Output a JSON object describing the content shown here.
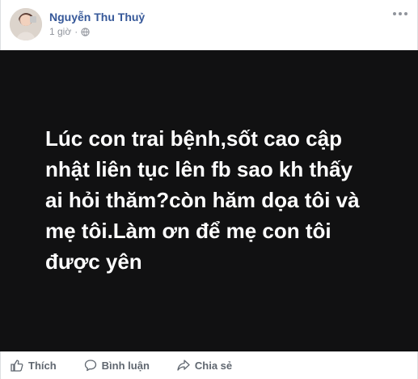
{
  "post": {
    "author": "Nguyễn Thu Thuỷ",
    "time": "1 giờ",
    "separator": "·",
    "status_text": "Lúc con trai bệnh,sốt cao cập\nnhật liên tục lên fb sao kh thấy\nai hỏi thăm?còn hăm dọa tôi và\nmẹ tôi.Làm ơn để mẹ con tôi\nđược yên"
  },
  "actions": {
    "like": "Thích",
    "comment": "Bình luận",
    "share": "Chia sẻ"
  },
  "colors": {
    "author_link": "#365899",
    "status_background": "#111112",
    "status_text": "#ffffff",
    "meta_text": "#90949c",
    "action_text": "#606770"
  },
  "icons": {
    "avatar": "profile-photo",
    "privacy": "globe-icon",
    "more": "ellipsis-icon",
    "like": "thumbs-up-icon",
    "comment": "comment-bubble-icon",
    "share": "share-arrow-icon"
  }
}
